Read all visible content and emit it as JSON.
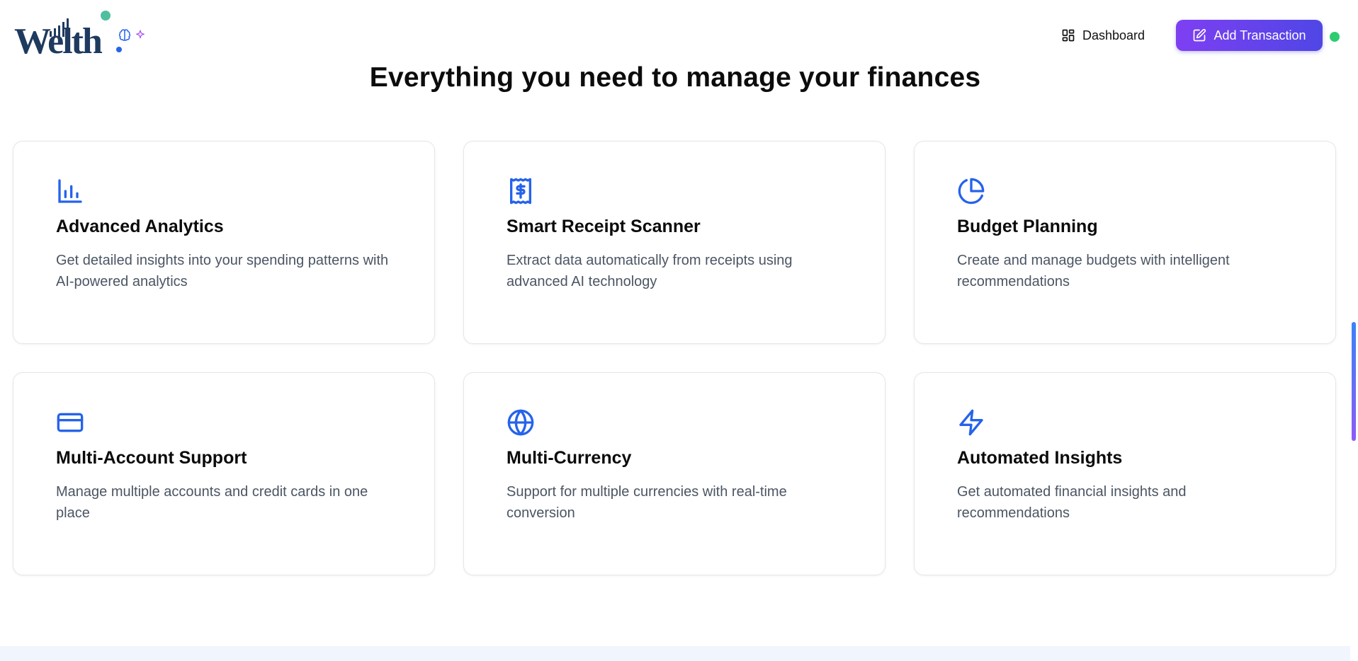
{
  "header": {
    "logo_text": "Welth",
    "nav_dashboard_label": "Dashboard",
    "add_transaction_label": "Add Transaction"
  },
  "headline": "Everything you need to manage your finances",
  "features": [
    {
      "icon": "bar-chart-icon",
      "title": "Advanced Analytics",
      "description": "Get detailed insights into your spending patterns with AI-powered analytics"
    },
    {
      "icon": "receipt-icon",
      "title": "Smart Receipt Scanner",
      "description": "Extract data automatically from receipts using advanced AI technology"
    },
    {
      "icon": "pie-chart-icon",
      "title": "Budget Planning",
      "description": "Create and manage budgets with intelligent recommendations"
    },
    {
      "icon": "credit-card-icon",
      "title": "Multi-Account Support",
      "description": "Manage multiple accounts and credit cards in one place"
    },
    {
      "icon": "globe-icon",
      "title": "Multi-Currency",
      "description": "Support for multiple currencies with real-time conversion"
    },
    {
      "icon": "zap-icon",
      "title": "Automated Insights",
      "description": "Get automated financial insights and recommendations"
    }
  ],
  "colors": {
    "accent_blue": "#2563eb",
    "button_gradient_start": "#7e3ff2",
    "button_gradient_end": "#4f46e5",
    "status_green": "#2ecc71"
  }
}
